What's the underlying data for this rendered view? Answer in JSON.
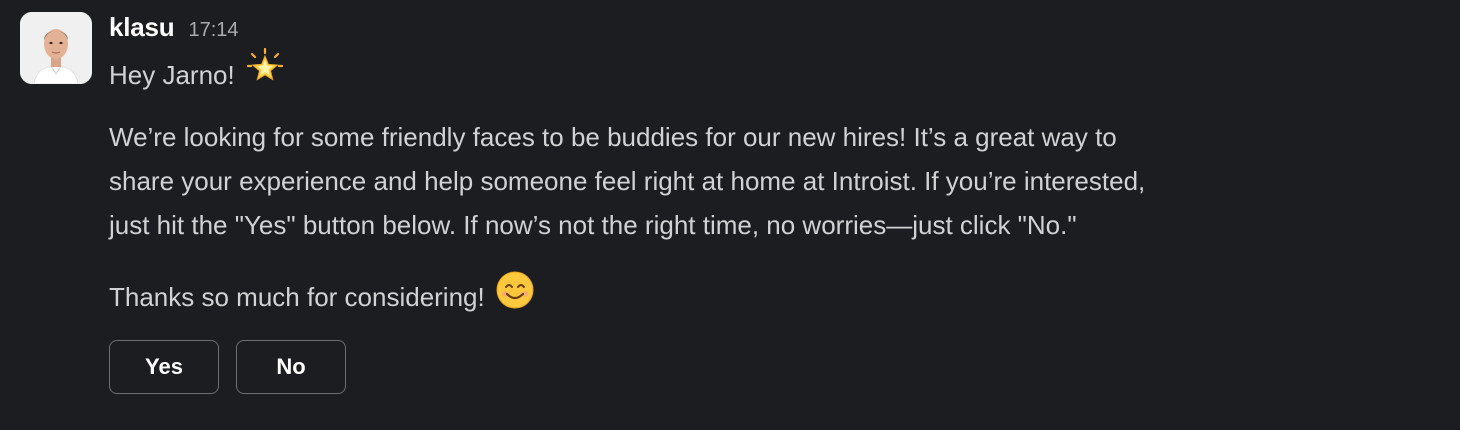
{
  "message": {
    "author": "klasu",
    "timestamp": "17:14",
    "greeting": "Hey Jarno!",
    "greeting_emoji": "glowing-star-emoji",
    "paragraph_lines": [
      "We’re looking for some friendly faces to be buddies for our new hires! It’s a great way to",
      "share your experience and help someone feel right at home at Introist. If you’re interested,",
      "just hit the \"Yes\" button below. If now’s not the right time, no worries—just click \"No.\""
    ],
    "closing": "Thanks so much for considering!",
    "closing_emoji": "smiling-face-emoji"
  },
  "actions": {
    "yes_label": "Yes",
    "no_label": "No"
  },
  "colors": {
    "background": "#1b1d21",
    "text": "#d1d2d3",
    "author": "#ffffff",
    "timestamp": "#ababad",
    "button_border": "#6d6f73"
  }
}
